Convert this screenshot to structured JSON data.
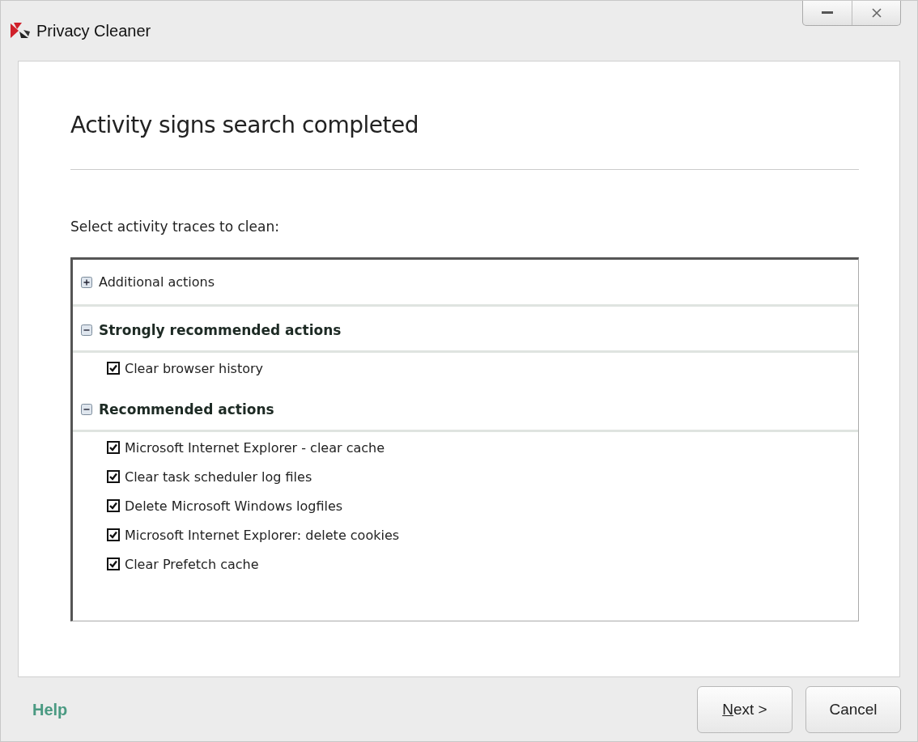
{
  "window": {
    "title": "Privacy Cleaner"
  },
  "heading": "Activity signs search completed",
  "prompt": "Select activity traces to clean:",
  "groups": [
    {
      "label": "Additional actions",
      "expanded": false,
      "emphasized": false
    },
    {
      "label": "Strongly recommended actions",
      "expanded": true,
      "emphasized": true,
      "items": [
        {
          "label": "Clear browser history",
          "checked": true
        }
      ]
    },
    {
      "label": "Recommended actions",
      "expanded": true,
      "emphasized": true,
      "items": [
        {
          "label": "Microsoft Internet Explorer - clear cache",
          "checked": true
        },
        {
          "label": "Clear task scheduler log files",
          "checked": true
        },
        {
          "label": "Delete Microsoft Windows logfiles",
          "checked": true
        },
        {
          "label": "Microsoft Internet Explorer: delete cookies",
          "checked": true
        },
        {
          "label": "Clear Prefetch cache",
          "checked": true
        }
      ]
    }
  ],
  "footer": {
    "help": "Help",
    "buttons": [
      {
        "label": "Next >",
        "kind": "mnemonic"
      },
      {
        "label": "Cancel",
        "kind": "plain"
      }
    ]
  }
}
